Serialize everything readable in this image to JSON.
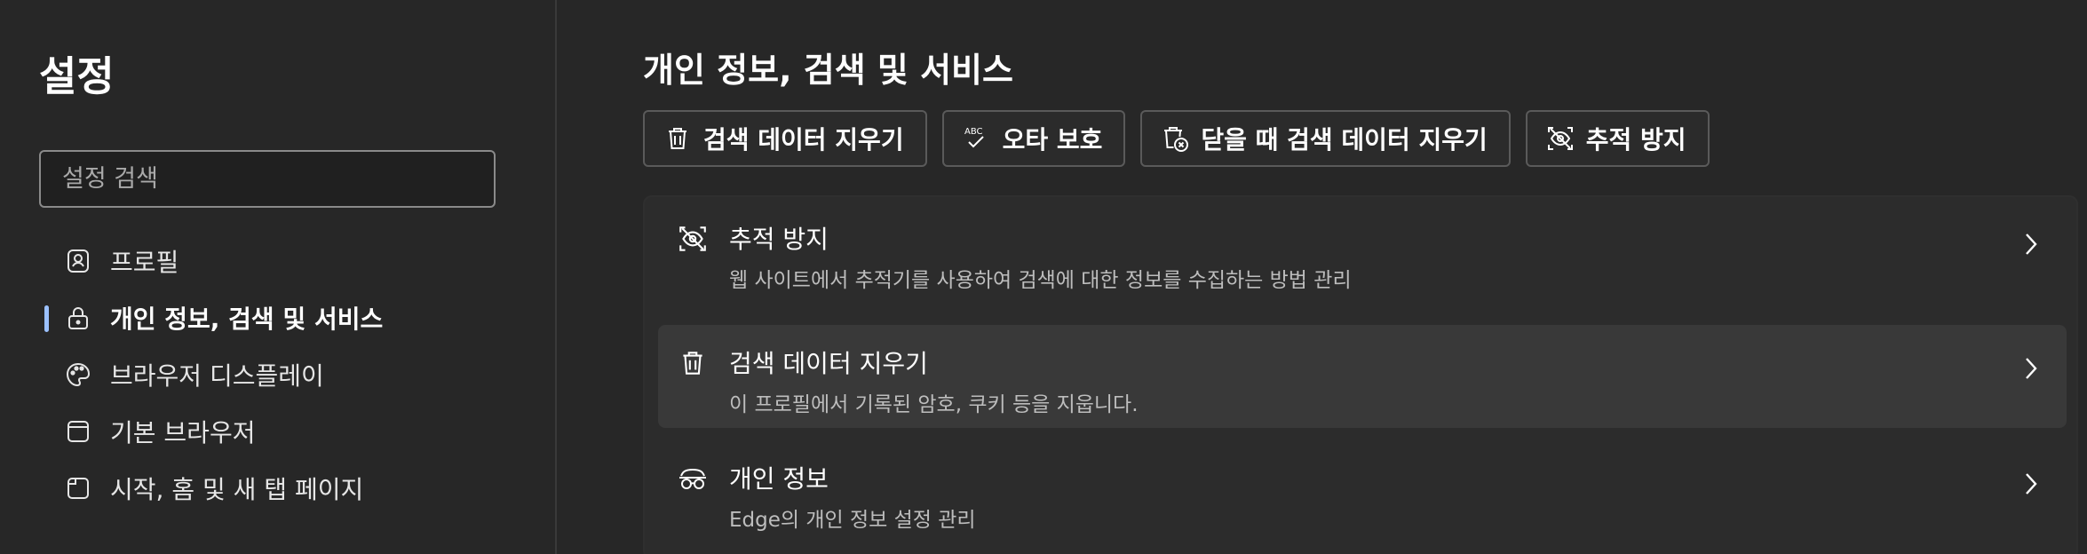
{
  "sidebar": {
    "title": "설정",
    "search": {
      "placeholder": "설정 검색",
      "value": ""
    },
    "items": [
      {
        "label": "프로필",
        "icon": "profile-icon",
        "active": false
      },
      {
        "label": "개인 정보, 검색 및 서비스",
        "icon": "lock-icon",
        "active": true
      },
      {
        "label": "브라우저 디스플레이",
        "icon": "palette-icon",
        "active": false
      },
      {
        "label": "기본 브라우저",
        "icon": "browser-window-icon",
        "active": false
      },
      {
        "label": "시작, 홈 및 새 탭 페이지",
        "icon": "new-tab-icon",
        "active": false
      }
    ]
  },
  "main": {
    "title": "개인 정보, 검색 및 서비스",
    "chips": [
      {
        "label": "검색 데이터 지우기",
        "icon": "trash-icon"
      },
      {
        "label": "오타 보호",
        "icon": "spellcheck-icon"
      },
      {
        "label": "닫을 때 검색 데이터 지우기",
        "icon": "trash-clock-icon"
      },
      {
        "label": "추적 방지",
        "icon": "tracking-prevention-icon"
      }
    ],
    "rows": [
      {
        "title": "추적 방지",
        "description": "웹 사이트에서 추적기를 사용하여 검색에 대한 정보를 수집하는 방법 관리",
        "icon": "tracking-prevention-icon"
      },
      {
        "title": "검색 데이터 지우기",
        "description": "이 프로필에서 기록된 암호, 쿠키 등을 지웁니다.",
        "icon": "trash-icon"
      },
      {
        "title": "개인 정보",
        "description": "Edge의 개인 정보 설정 관리",
        "icon": "glasses-icon"
      }
    ]
  },
  "colors": {
    "background": "#272727",
    "accent": "#9bc1ff",
    "card": "#2c2c2c",
    "row_highlight": "#393939"
  }
}
